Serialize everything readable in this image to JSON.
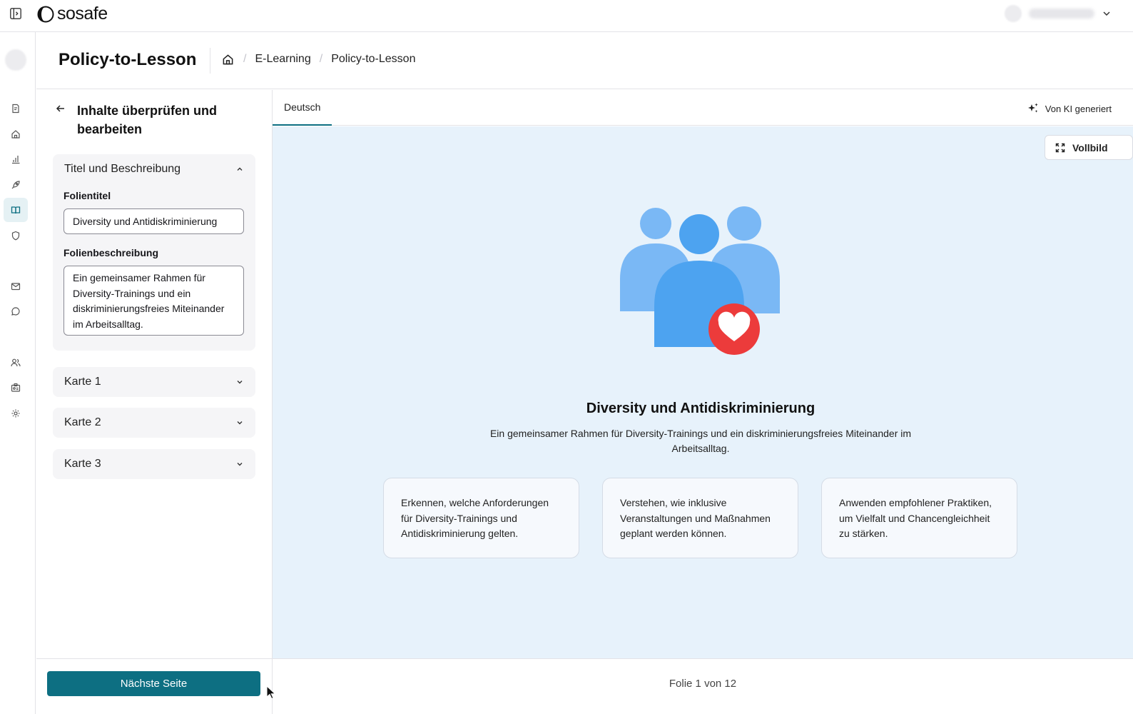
{
  "app": {
    "brand": "sosafe",
    "user_name": "Hidden user"
  },
  "header": {
    "title": "Policy-to-Lesson",
    "breadcrumb": [
      "E-Learning",
      "Policy-to-Lesson"
    ]
  },
  "rail": {
    "items": [
      "report-icon",
      "home-icon",
      "analytics-icon",
      "rocket-icon",
      "book-icon",
      "shield-icon",
      "mail-icon",
      "chat-icon",
      "users-icon",
      "badge-icon",
      "gear-icon"
    ],
    "active": "book-icon"
  },
  "panel": {
    "title": "Inhalte überprüfen und bearbeiten",
    "sections": [
      {
        "title": "Titel und Beschreibung",
        "expanded": true,
        "fields": {
          "slide_title_label": "Folientitel",
          "slide_title_value": "Diversity und Antidiskriminierung",
          "slide_desc_label": "Folienbeschreibung",
          "slide_desc_value": "Ein gemeinsamer Rahmen für Diversity-Trainings und ein diskriminierungsfreies Miteinander im Arbeitsalltag."
        }
      },
      {
        "title": "Karte 1",
        "expanded": false
      },
      {
        "title": "Karte 2",
        "expanded": false
      },
      {
        "title": "Karte 3",
        "expanded": false
      }
    ],
    "next_button": "Nächste Seite"
  },
  "preview": {
    "tab": "Deutsch",
    "ai_badge": "Von KI generiert",
    "fullscreen": "Vollbild",
    "slide_title": "Diversity und Antidiskriminierung",
    "slide_desc": "Ein gemeinsamer Rahmen für Diversity-Trainings und ein diskriminierungsfreies Miteinander im Arbeitsalltag.",
    "cards": [
      "Erkennen, welche Anforderungen für Diversity-Trainings und Antidiskriminierung gelten.",
      "Verstehen, wie inklusive Veranstaltungen und Maßnahmen geplant werden können.",
      "Anwenden empfohlener Praktiken, um Vielfalt und Chancengleichheit zu stärken."
    ],
    "counter": "Folie 1 von 12"
  },
  "colors": {
    "accent": "#0d6f82",
    "preview_bg": "#e7f2fb",
    "people_light": "#7ab8f5",
    "people_dark": "#4da3f0",
    "heart_red": "#ec3b3b"
  }
}
